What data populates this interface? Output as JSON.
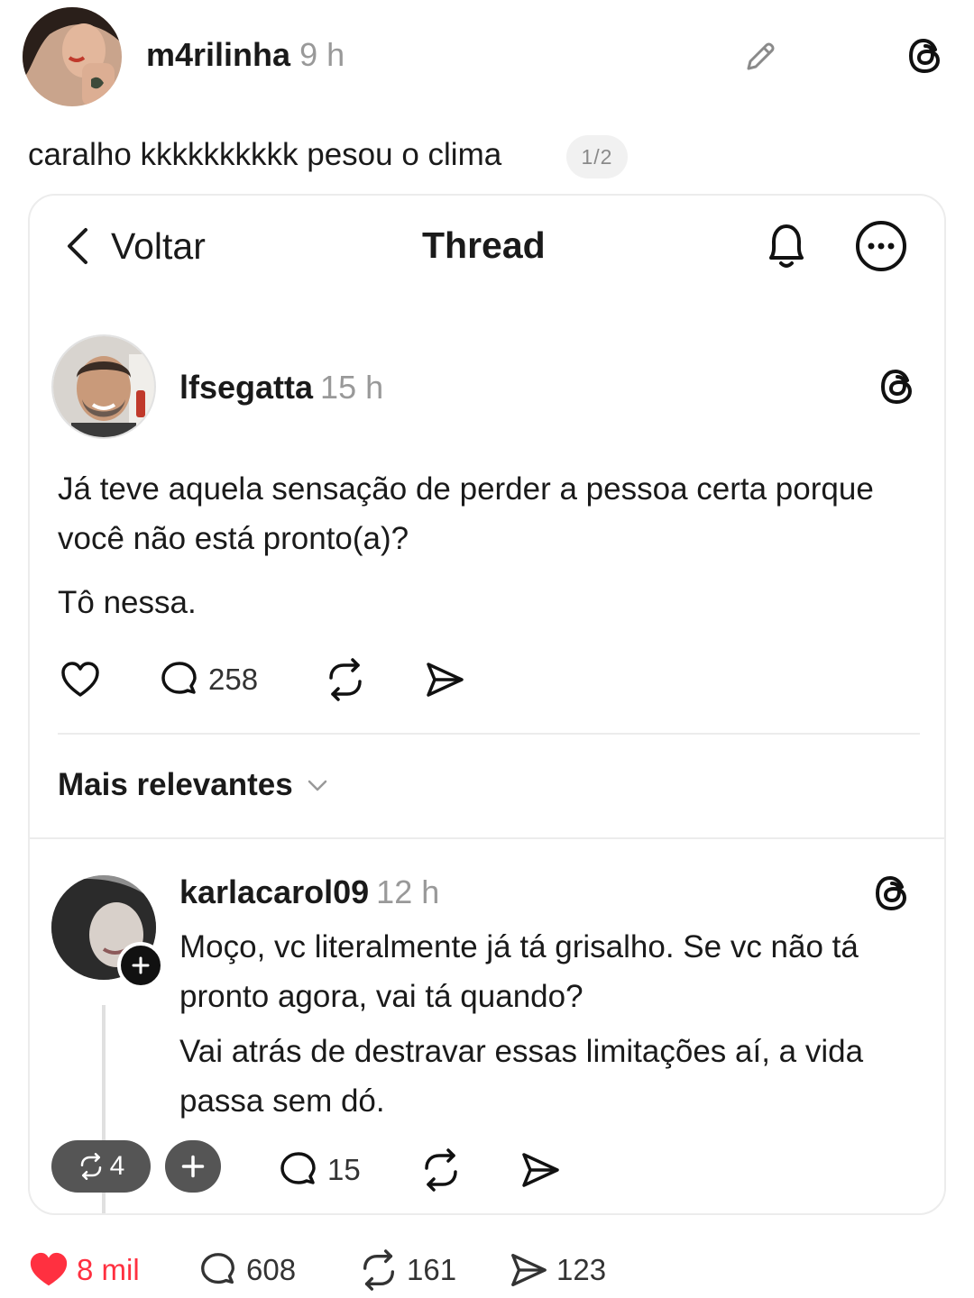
{
  "outer_post": {
    "username": "m4rilinha",
    "time": "9 h",
    "caption": "caralho kkkkkkkkkk pesou o clima",
    "page_indicator": "1/2",
    "stats": {
      "likes": "8 mil",
      "comments": "608",
      "reposts": "161",
      "shares": "123"
    },
    "like_color": "#ff3040"
  },
  "embedded": {
    "nav": {
      "back_label": "Voltar",
      "title": "Thread"
    },
    "post": {
      "username": "lfsegatta",
      "time": "15 h",
      "text": "Já teve aquela sensação de perder a pessoa certa porque você não está pronto(a)?",
      "text2": "Tô nessa.",
      "comments": "258"
    },
    "sort_label": "Mais relevantes",
    "reply": {
      "username": "karlacarol09",
      "time": "12 h",
      "text": "Moço, vc literalmente já tá grisalho. Se vc não tá pronto agora, vai tá quando?",
      "text2": "Vai atrás de destravar essas limitações aí, a vida passa sem dó.",
      "repost_count": "4",
      "comments": "15"
    }
  },
  "icons": [
    "pencil-icon",
    "threads-logo-icon",
    "chevron-left-icon",
    "bell-icon",
    "more-icon",
    "heart-icon",
    "comment-icon",
    "repost-icon",
    "share-icon",
    "chevron-down-icon",
    "plus-icon"
  ]
}
